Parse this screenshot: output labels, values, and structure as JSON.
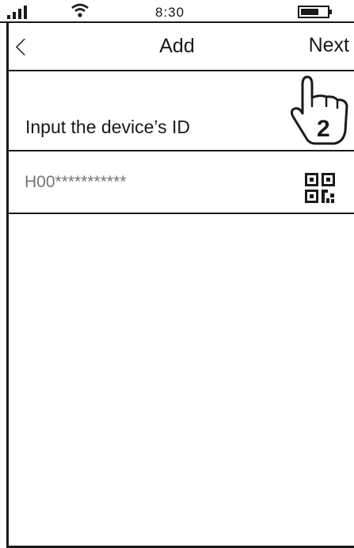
{
  "status_bar": {
    "time": "8:30",
    "signal_icon": "signal-bars-icon",
    "wifi_icon": "wifi-icon",
    "battery_icon": "battery-icon"
  },
  "nav": {
    "back_icon": "chevron-left-icon",
    "title": "Add",
    "next_label": "Next"
  },
  "annotation": {
    "step_number": "2",
    "pointer_icon": "pointing-hand-icon"
  },
  "form": {
    "label": "Input the device’s ID",
    "device_id_placeholder": "H00***********",
    "qr_icon": "qr-code-icon"
  },
  "colors": {
    "ink": "#1a1a1a",
    "placeholder": "#999999",
    "background": "#ffffff"
  }
}
